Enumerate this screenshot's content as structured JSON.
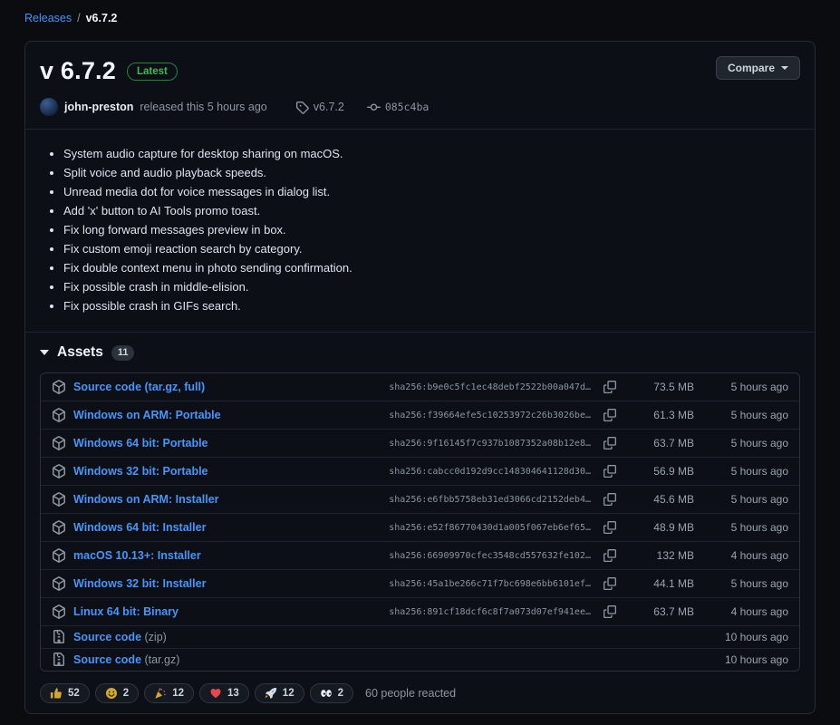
{
  "breadcrumb": {
    "releases_link": "Releases",
    "separator": "/",
    "current": "v6.7.2"
  },
  "header": {
    "title": "v 6.7.2",
    "latest_badge": "Latest",
    "compare_label": "Compare",
    "author": "john-preston",
    "released_text": "released this 5 hours ago",
    "tag_label": "v6.7.2",
    "commit_sha": "085c4ba"
  },
  "notes": [
    "System audio capture for desktop sharing on macOS.",
    "Split voice and audio playback speeds.",
    "Unread media dot for voice messages in dialog list.",
    "Add 'x' button to AI Tools promo toast.",
    "Fix long forward messages preview in box.",
    "Fix custom emoji reaction search by category.",
    "Fix double context menu in photo sending confirmation.",
    "Fix possible crash in middle-elision.",
    "Fix possible crash in GIFs search."
  ],
  "assets": {
    "section_label": "Assets",
    "count": "11",
    "rows": [
      {
        "icon": "package-icon",
        "name": "Source code (tar.gz, full)",
        "hash": "sha256:b9e0c5fc1ec48debf2522b00a047d…",
        "size": "73.5 MB",
        "time": "5 hours ago"
      },
      {
        "icon": "package-icon",
        "name": "Windows on ARM: Portable",
        "hash": "sha256:f39664efe5c10253972c26b3026be…",
        "size": "61.3 MB",
        "time": "5 hours ago"
      },
      {
        "icon": "package-icon",
        "name": "Windows 64 bit: Portable",
        "hash": "sha256:9f16145f7c937b1087352a08b12e8…",
        "size": "63.7 MB",
        "time": "5 hours ago"
      },
      {
        "icon": "package-icon",
        "name": "Windows 32 bit: Portable",
        "hash": "sha256:cabcc0d192d9cc148304641128d30…",
        "size": "56.9 MB",
        "time": "5 hours ago"
      },
      {
        "icon": "package-icon",
        "name": "Windows on ARM: Installer",
        "hash": "sha256:e6fbb5758eb31ed3066cd2152deb4…",
        "size": "45.6 MB",
        "time": "5 hours ago"
      },
      {
        "icon": "package-icon",
        "name": "Windows 64 bit: Installer",
        "hash": "sha256:e52f86770430d1a005f067eb6ef65…",
        "size": "48.9 MB",
        "time": "5 hours ago"
      },
      {
        "icon": "package-icon",
        "name": "macOS 10.13+: Installer",
        "hash": "sha256:66909970cfec3548cd557632fe102…",
        "size": "132 MB",
        "time": "4 hours ago"
      },
      {
        "icon": "package-icon",
        "name": "Windows 32 bit: Installer",
        "hash": "sha256:45a1be266c71f7bc698e6bb6101ef…",
        "size": "44.1 MB",
        "time": "5 hours ago"
      },
      {
        "icon": "package-icon",
        "name": "Linux 64 bit: Binary",
        "hash": "sha256:891cf18dcf6c8f7a073d07ef941ee…",
        "size": "63.7 MB",
        "time": "4 hours ago"
      },
      {
        "icon": "file-zip-icon",
        "name": "Source code",
        "suffix": "(zip)",
        "time": "10 hours ago"
      },
      {
        "icon": "file-zip-icon",
        "name": "Source code",
        "suffix": "(tar.gz)",
        "time": "10 hours ago"
      }
    ]
  },
  "reactions": {
    "items": [
      {
        "name": "thumbs-up",
        "emoji": "👍",
        "count": "52"
      },
      {
        "name": "smile",
        "emoji": "😄",
        "count": "2"
      },
      {
        "name": "tada",
        "emoji": "🎉",
        "count": "12"
      },
      {
        "name": "heart",
        "emoji": "❤️",
        "count": "13"
      },
      {
        "name": "rocket",
        "emoji": "🚀",
        "count": "12"
      },
      {
        "name": "eyes",
        "emoji": "👀",
        "count": "2"
      }
    ],
    "summary": "60 people reacted"
  },
  "colors": {
    "page_bg": "#0a0c10",
    "link_blue": "#4795f9",
    "latest_green": "#3fb950",
    "muted_text": "#8d96a0",
    "border": "#2b313a"
  }
}
